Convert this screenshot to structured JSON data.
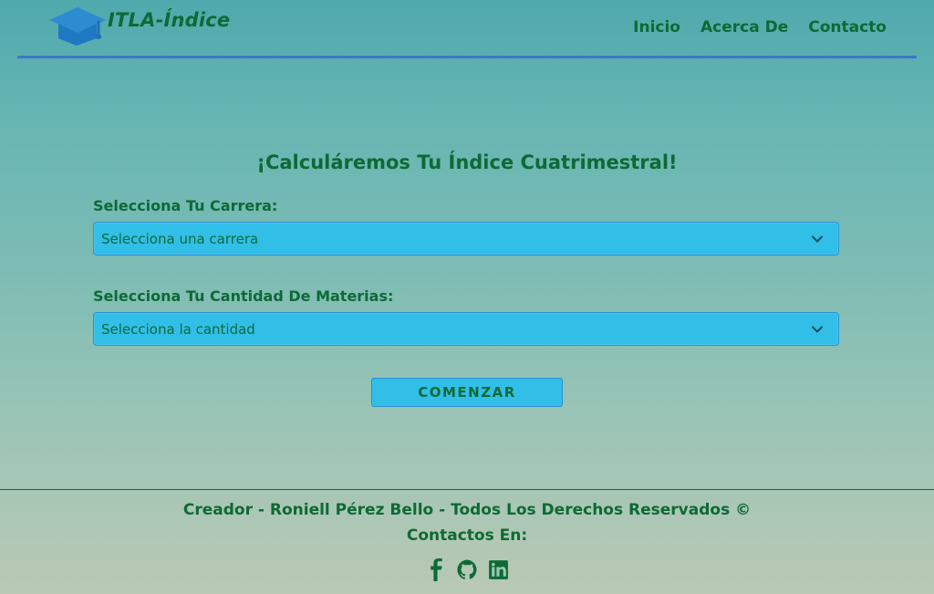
{
  "header": {
    "brand_title": "ITLA-Índice",
    "nav": [
      {
        "label": "Inicio"
      },
      {
        "label": "Acerca De"
      },
      {
        "label": "Contacto"
      }
    ]
  },
  "main": {
    "title": "¡Calculáremos Tu Índice Cuatrimestral!",
    "career_label": "Selecciona Tu Carrera:",
    "career_select_value": "Selecciona una carrera",
    "subjects_label": "Selecciona Tu Cantidad De Materias:",
    "subjects_select_value": "Selecciona la cantidad",
    "start_button": "COMENZAR"
  },
  "footer": {
    "creator_text": "Creador - Roniell Pérez Bello - Todos Los Derechos Reservados ©",
    "contacts_text": "Contactos En:",
    "social_icons": [
      "facebook-icon",
      "github-icon",
      "linkedin-icon"
    ]
  },
  "colors": {
    "text_green": "#0d6a35",
    "field_blue": "#31bfe8",
    "header_line_blue": "#3e74c7",
    "footer_line": "#285b3e"
  },
  "icons": {
    "logo": "graduation-cap-icon",
    "select_indicator": "chevron-down-icon"
  }
}
